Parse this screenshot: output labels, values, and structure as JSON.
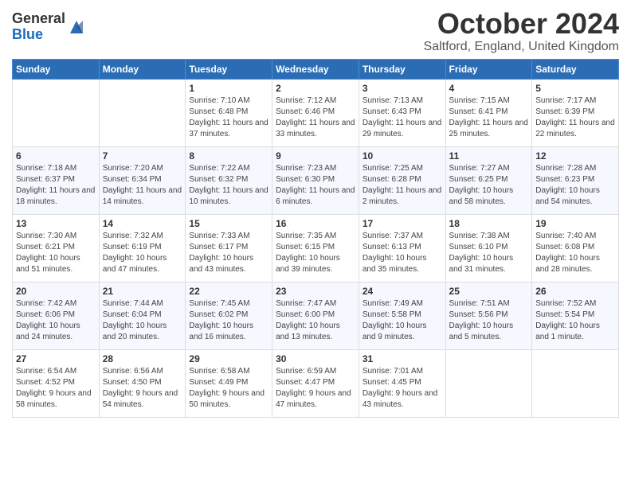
{
  "header": {
    "logo_general": "General",
    "logo_blue": "Blue",
    "month_title": "October 2024",
    "location": "Saltford, England, United Kingdom"
  },
  "days_of_week": [
    "Sunday",
    "Monday",
    "Tuesday",
    "Wednesday",
    "Thursday",
    "Friday",
    "Saturday"
  ],
  "weeks": [
    [
      {
        "day": "",
        "info": ""
      },
      {
        "day": "",
        "info": ""
      },
      {
        "day": "1",
        "info": "Sunrise: 7:10 AM\nSunset: 6:48 PM\nDaylight: 11 hours and 37 minutes."
      },
      {
        "day": "2",
        "info": "Sunrise: 7:12 AM\nSunset: 6:46 PM\nDaylight: 11 hours and 33 minutes."
      },
      {
        "day": "3",
        "info": "Sunrise: 7:13 AM\nSunset: 6:43 PM\nDaylight: 11 hours and 29 minutes."
      },
      {
        "day": "4",
        "info": "Sunrise: 7:15 AM\nSunset: 6:41 PM\nDaylight: 11 hours and 25 minutes."
      },
      {
        "day": "5",
        "info": "Sunrise: 7:17 AM\nSunset: 6:39 PM\nDaylight: 11 hours and 22 minutes."
      }
    ],
    [
      {
        "day": "6",
        "info": "Sunrise: 7:18 AM\nSunset: 6:37 PM\nDaylight: 11 hours and 18 minutes."
      },
      {
        "day": "7",
        "info": "Sunrise: 7:20 AM\nSunset: 6:34 PM\nDaylight: 11 hours and 14 minutes."
      },
      {
        "day": "8",
        "info": "Sunrise: 7:22 AM\nSunset: 6:32 PM\nDaylight: 11 hours and 10 minutes."
      },
      {
        "day": "9",
        "info": "Sunrise: 7:23 AM\nSunset: 6:30 PM\nDaylight: 11 hours and 6 minutes."
      },
      {
        "day": "10",
        "info": "Sunrise: 7:25 AM\nSunset: 6:28 PM\nDaylight: 11 hours and 2 minutes."
      },
      {
        "day": "11",
        "info": "Sunrise: 7:27 AM\nSunset: 6:25 PM\nDaylight: 10 hours and 58 minutes."
      },
      {
        "day": "12",
        "info": "Sunrise: 7:28 AM\nSunset: 6:23 PM\nDaylight: 10 hours and 54 minutes."
      }
    ],
    [
      {
        "day": "13",
        "info": "Sunrise: 7:30 AM\nSunset: 6:21 PM\nDaylight: 10 hours and 51 minutes."
      },
      {
        "day": "14",
        "info": "Sunrise: 7:32 AM\nSunset: 6:19 PM\nDaylight: 10 hours and 47 minutes."
      },
      {
        "day": "15",
        "info": "Sunrise: 7:33 AM\nSunset: 6:17 PM\nDaylight: 10 hours and 43 minutes."
      },
      {
        "day": "16",
        "info": "Sunrise: 7:35 AM\nSunset: 6:15 PM\nDaylight: 10 hours and 39 minutes."
      },
      {
        "day": "17",
        "info": "Sunrise: 7:37 AM\nSunset: 6:13 PM\nDaylight: 10 hours and 35 minutes."
      },
      {
        "day": "18",
        "info": "Sunrise: 7:38 AM\nSunset: 6:10 PM\nDaylight: 10 hours and 31 minutes."
      },
      {
        "day": "19",
        "info": "Sunrise: 7:40 AM\nSunset: 6:08 PM\nDaylight: 10 hours and 28 minutes."
      }
    ],
    [
      {
        "day": "20",
        "info": "Sunrise: 7:42 AM\nSunset: 6:06 PM\nDaylight: 10 hours and 24 minutes."
      },
      {
        "day": "21",
        "info": "Sunrise: 7:44 AM\nSunset: 6:04 PM\nDaylight: 10 hours and 20 minutes."
      },
      {
        "day": "22",
        "info": "Sunrise: 7:45 AM\nSunset: 6:02 PM\nDaylight: 10 hours and 16 minutes."
      },
      {
        "day": "23",
        "info": "Sunrise: 7:47 AM\nSunset: 6:00 PM\nDaylight: 10 hours and 13 minutes."
      },
      {
        "day": "24",
        "info": "Sunrise: 7:49 AM\nSunset: 5:58 PM\nDaylight: 10 hours and 9 minutes."
      },
      {
        "day": "25",
        "info": "Sunrise: 7:51 AM\nSunset: 5:56 PM\nDaylight: 10 hours and 5 minutes."
      },
      {
        "day": "26",
        "info": "Sunrise: 7:52 AM\nSunset: 5:54 PM\nDaylight: 10 hours and 1 minute."
      }
    ],
    [
      {
        "day": "27",
        "info": "Sunrise: 6:54 AM\nSunset: 4:52 PM\nDaylight: 9 hours and 58 minutes."
      },
      {
        "day": "28",
        "info": "Sunrise: 6:56 AM\nSunset: 4:50 PM\nDaylight: 9 hours and 54 minutes."
      },
      {
        "day": "29",
        "info": "Sunrise: 6:58 AM\nSunset: 4:49 PM\nDaylight: 9 hours and 50 minutes."
      },
      {
        "day": "30",
        "info": "Sunrise: 6:59 AM\nSunset: 4:47 PM\nDaylight: 9 hours and 47 minutes."
      },
      {
        "day": "31",
        "info": "Sunrise: 7:01 AM\nSunset: 4:45 PM\nDaylight: 9 hours and 43 minutes."
      },
      {
        "day": "",
        "info": ""
      },
      {
        "day": "",
        "info": ""
      }
    ]
  ]
}
